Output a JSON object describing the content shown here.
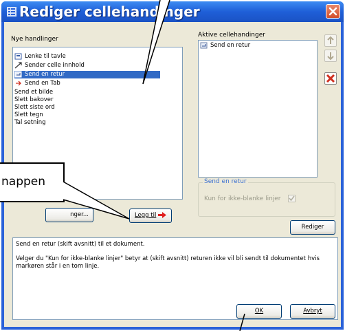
{
  "window": {
    "title": "Rediger cellehandinger"
  },
  "left_panel": {
    "label": "Nye handlinger",
    "items": [
      {
        "label": "Lenke til tavle",
        "icon": "board-link-icon"
      },
      {
        "label": "Sender celle innhold",
        "icon": "arrow-icon"
      },
      {
        "label": "Send en retur",
        "icon": "return-icon",
        "selected": true
      },
      {
        "label": "Send en Tab",
        "icon": "tab-icon"
      },
      {
        "label": "Send et bilde"
      },
      {
        "label": "Slett bakover"
      },
      {
        "label": "Slett siste ord"
      },
      {
        "label": "Slett tegn"
      },
      {
        "label": "Tal setning"
      }
    ],
    "edit_button_partial": "nger...",
    "add_button": "Legg til"
  },
  "right_panel": {
    "label": "Aktive cellehandinger",
    "items": [
      {
        "label": "Send en retur",
        "icon": "return-icon"
      }
    ],
    "group_title": "Send en retur",
    "checkbox_label": "Kun for ikke-blanke linjer",
    "checkbox_checked": true,
    "edit_button": "Rediger"
  },
  "description": {
    "line1": "Send en retur (skift avsnitt) til et dokument.",
    "line2": "Velger du \"Kun for ikke-blanke linjer\" betyr at (skift avsnitt) returen ikke vil bli sendt til dokumentet hvis markøren står i en tom linje."
  },
  "footer": {
    "ok": "OK",
    "cancel": "Avbryt"
  },
  "callout": {
    "text": "nappen"
  },
  "colors": {
    "title_bar": "#2a62d9",
    "selection": "#316ac5",
    "delete_red": "#d03020",
    "arrow_red": "#e02020"
  }
}
